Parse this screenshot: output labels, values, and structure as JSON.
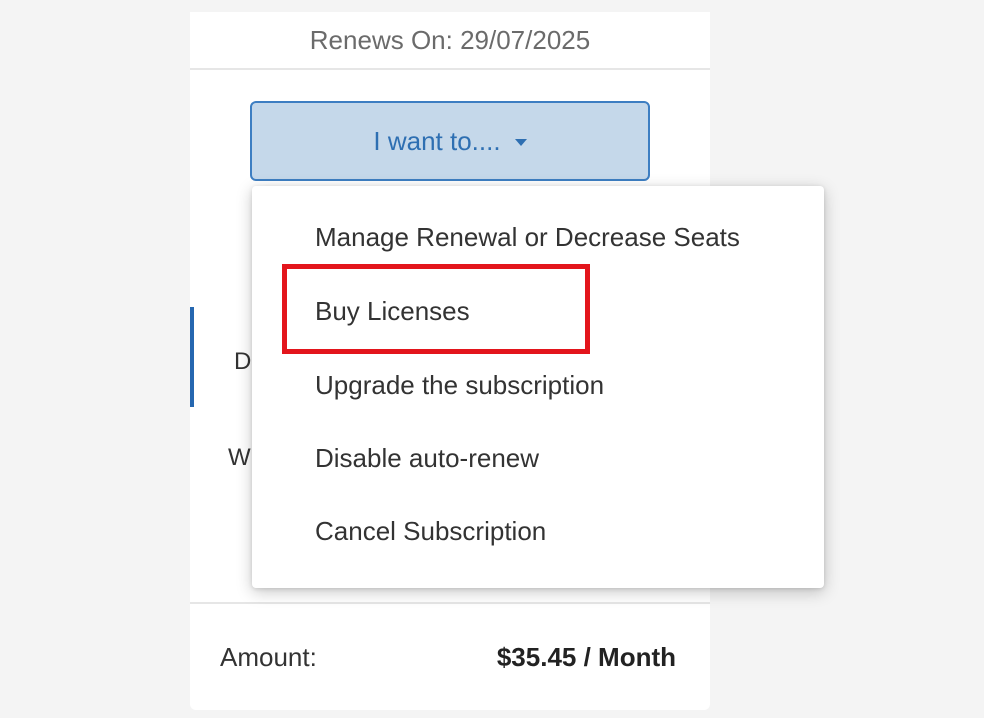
{
  "subscription": {
    "renews_on": "Renews On: 29/07/2025",
    "i_want_button_label": "I want to....",
    "tab_partial_label": "D",
    "partial_row_label": "W",
    "amount_label": "Amount:",
    "amount_value": "$35.45 / Month"
  },
  "menu": {
    "items": [
      "Manage Renewal or Decrease Seats",
      "Buy Licenses",
      "Upgrade the subscription",
      "Disable auto-renew",
      "Cancel Subscription"
    ],
    "highlighted_item": "Buy Licenses"
  },
  "colors": {
    "button_bg": "#c5d8ea",
    "button_border": "#3d7ec2",
    "button_text": "#2e6fb2",
    "highlight": "#e3151c",
    "tab_accent": "#2567b0"
  },
  "icons": {
    "dropdown": "caret-down-icon"
  }
}
